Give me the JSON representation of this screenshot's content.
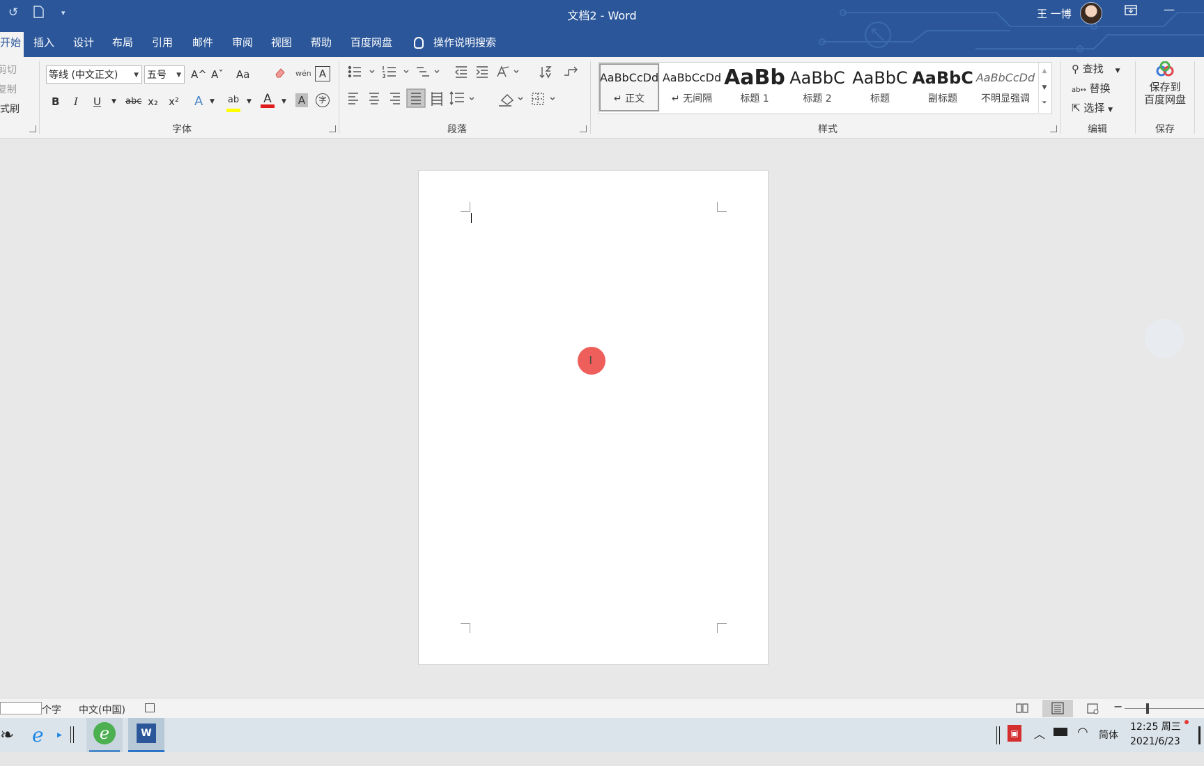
{
  "window": {
    "title": "文档2  -  Word",
    "user_name": "王 一博"
  },
  "tabs": {
    "home": "开始",
    "items": [
      "插入",
      "设计",
      "布局",
      "引用",
      "邮件",
      "审阅",
      "视图",
      "帮助",
      "百度网盘"
    ],
    "tell_me": "操作说明搜索"
  },
  "clipboard": {
    "cut": "剪切",
    "copy": "复制",
    "format_painter": "格式刷"
  },
  "font": {
    "family": "等线 (中文正文)",
    "size": "五号",
    "group_label": "字体",
    "bold": "B",
    "italic": "I",
    "underline": "U",
    "strike": "abc",
    "subscript": "x₂",
    "superscript": "x²",
    "grow": "A^",
    "shrink": "Aˇ",
    "change_case": "Aa",
    "pinyin": "wén",
    "border_char": "A",
    "text_effects": "A",
    "highlight": "ab",
    "font_color": "A",
    "shading_char": "A",
    "enclose_char": "字",
    "font_color_hex": "#e01b1b",
    "highlight_hex": "#ffff00"
  },
  "paragraph": {
    "group_label": "段落"
  },
  "styles": {
    "group_label": "样式",
    "items": [
      {
        "sample": "AaBbCcDd",
        "name": "↵ 正文"
      },
      {
        "sample": "AaBbCcDd",
        "name": "↵ 无间隔"
      },
      {
        "sample": "AaBb",
        "name": "标题 1"
      },
      {
        "sample": "AaBbC",
        "name": "标题 2"
      },
      {
        "sample": "AaBbC",
        "name": "标题"
      },
      {
        "sample": "AaBbC",
        "name": "副标题"
      },
      {
        "sample": "AaBbCcDd",
        "name": "不明显强调"
      }
    ]
  },
  "editing": {
    "group_label": "编辑",
    "find": "查找",
    "replace": "替换",
    "select": "选择"
  },
  "save_group": {
    "button": "保存到\n百度网盘",
    "line1": "保存到",
    "line2": "百度网盘",
    "group_label": "保存"
  },
  "statusbar": {
    "word_count": "个字",
    "language": "中文(中国)"
  },
  "taskbar": {
    "ime": "简体",
    "time": "12:25 周三",
    "date": "2021/6/23"
  },
  "colors": {
    "word_blue": "#2b579a",
    "click_indicator": "#ee5f5b"
  }
}
